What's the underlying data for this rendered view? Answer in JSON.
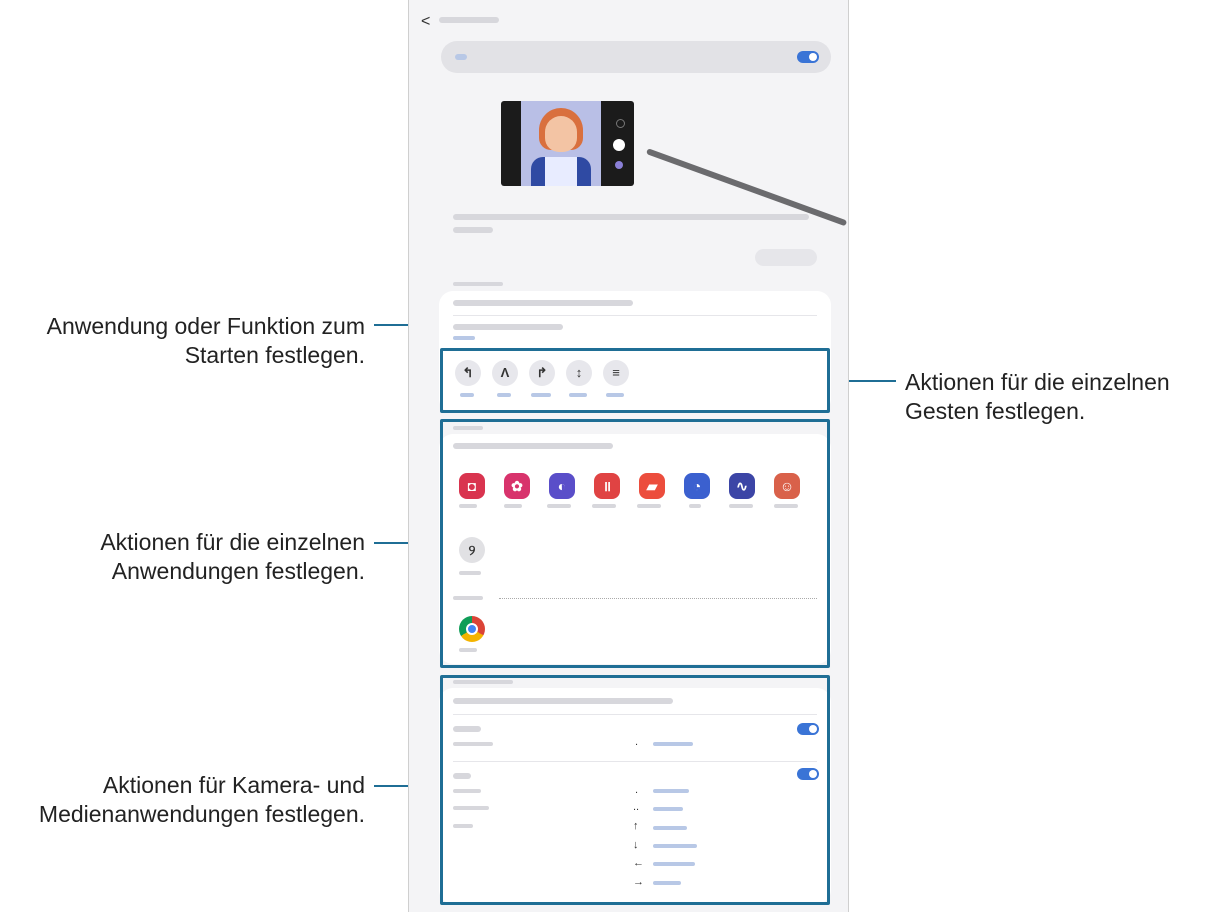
{
  "callouts": {
    "launch": "Anwendung oder Funktion zum\nStarten festlegen.",
    "gestures": "Aktionen für die einzelnen\nGesten festlegen.",
    "apps": "Aktionen für die einzelnen\nAnwendungen festlegen.",
    "media": "Aktionen für Kamera- und\nMedienanwendungen festlegen."
  },
  "icons": {
    "back": "chevron-left-icon",
    "gestures": [
      "swipe-left-gesture-icon",
      "swipe-up-gesture-icon",
      "swipe-right-gesture-icon",
      "up-down-gesture-icon",
      "circle-gesture-icon"
    ],
    "apps": [
      "camera-app-icon",
      "gallery-app-icon",
      "internet-app-icon",
      "voice-recorder-app-icon",
      "notes-app-icon",
      "screen-recorder-app-icon",
      "penup-app-icon",
      "ar-emoji-app-icon",
      "clip-studio-app-icon"
    ],
    "installed": [
      "chrome-app-icon"
    ]
  },
  "media_symbols": [
    ".",
    ".",
    "..",
    "↑",
    "↓",
    "←",
    "→"
  ],
  "colors": {
    "accent": "#1f6e95",
    "toggle_on": "#3a74d6"
  }
}
